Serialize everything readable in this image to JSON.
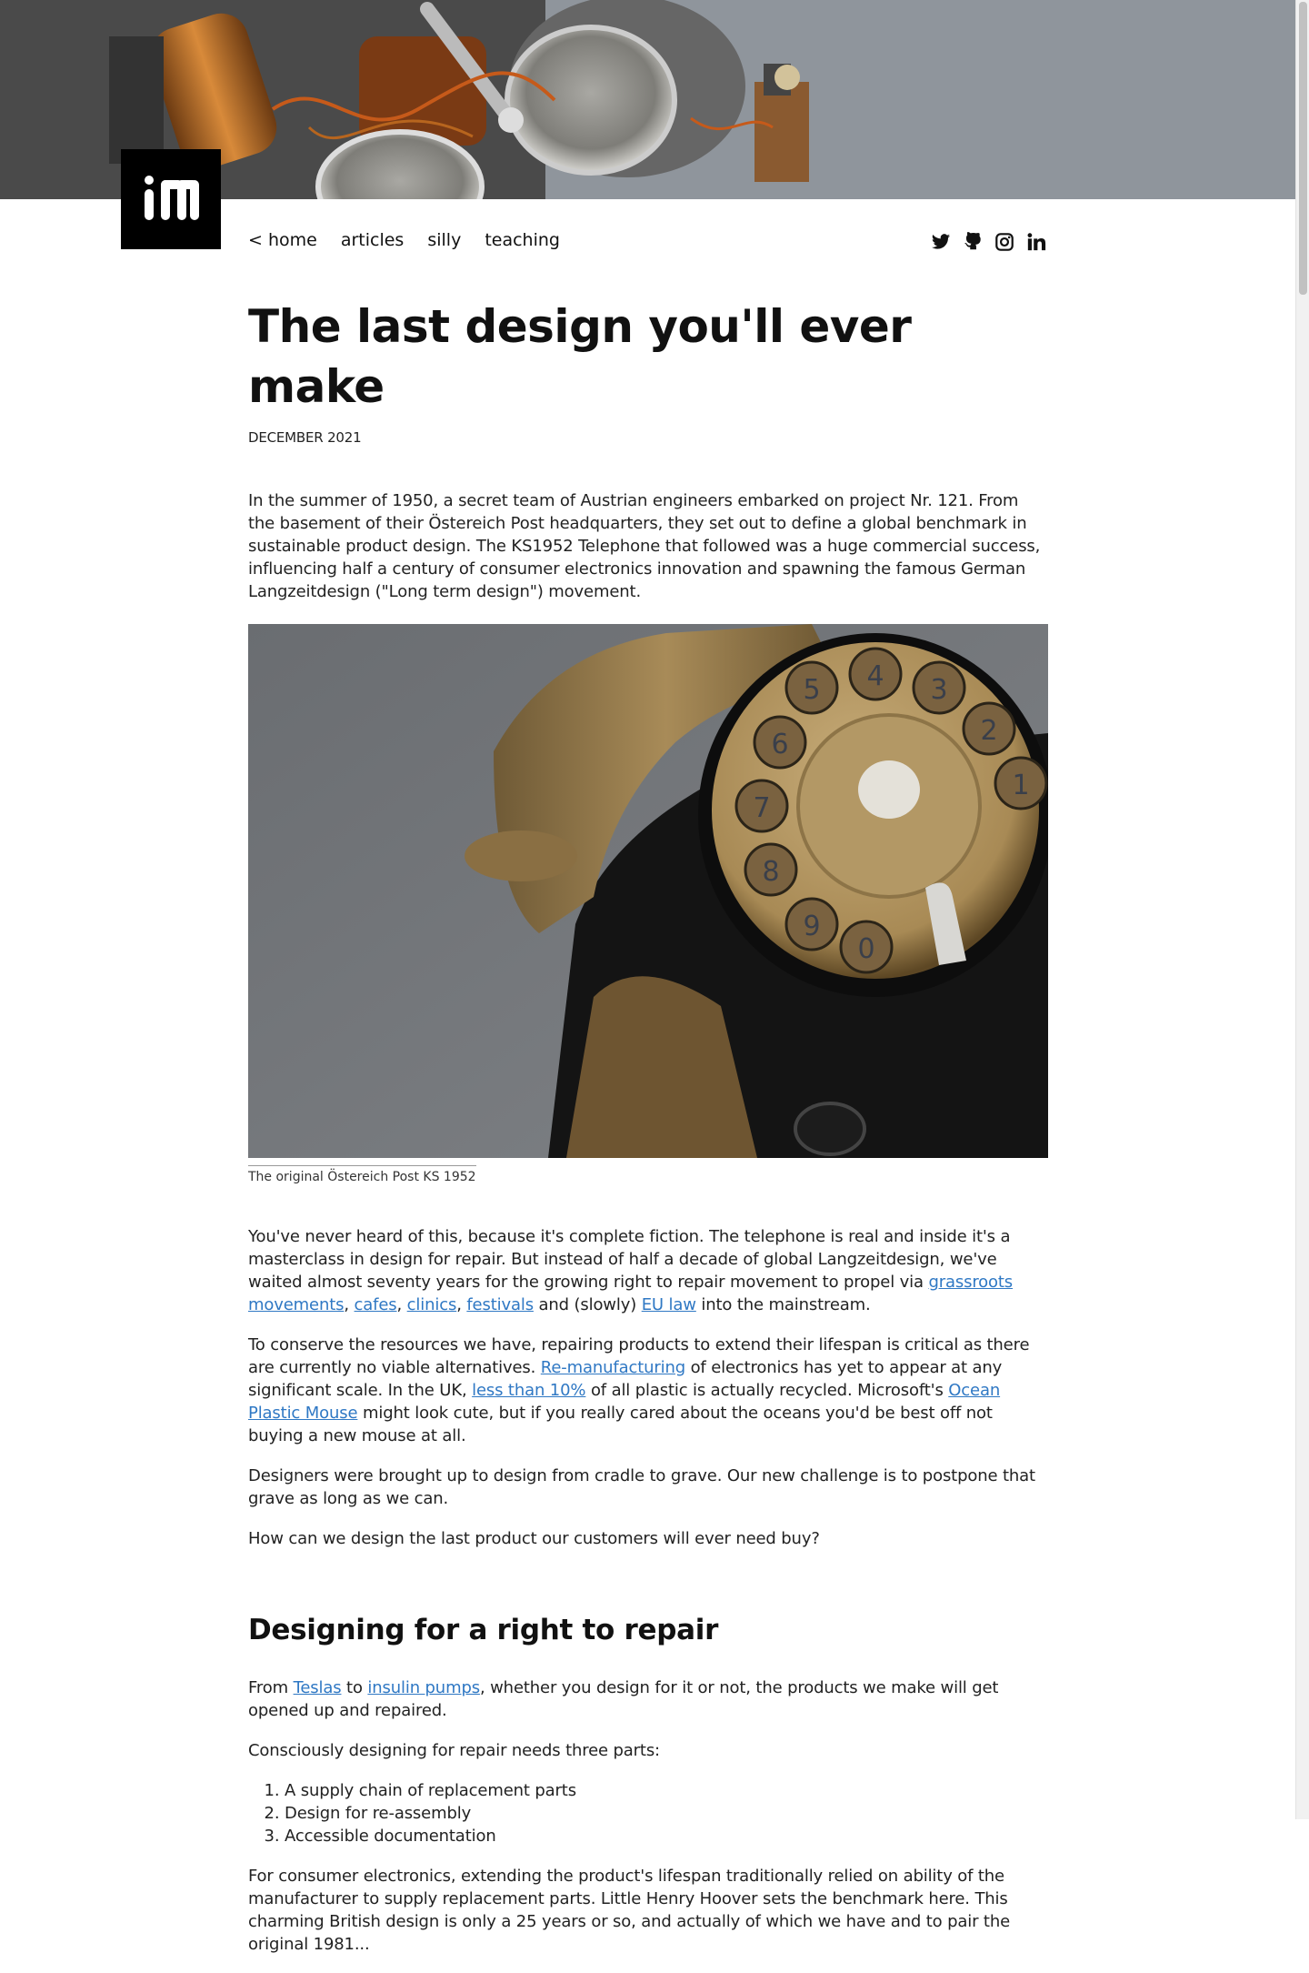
{
  "hero": {
    "alt": "Disassembled telephone internals"
  },
  "logo": {
    "label": "irl logo"
  },
  "nav": {
    "home": "< home",
    "articles": "articles",
    "silly": "silly",
    "teaching": "teaching"
  },
  "social": [
    "twitter-icon",
    "github-icon",
    "instagram-icon",
    "linkedin-icon"
  ],
  "article": {
    "title": "The last design you'll ever make",
    "date": "DECEMBER 2021",
    "intro": "In the summer of 1950, a secret team of Austrian engineers embarked on project Nr. 121. From the basement of their Östereich Post headquarters, they set out to define a global benchmark in sustainable product design. The KS1952 Telephone that followed was a huge commercial success, influencing half a century of consumer electronics innovation and spawning the famous German Langzeitdesign (\"Long term design\") movement.",
    "caption": "The original Östereich Post KS 1952",
    "p2": {
      "a": "You've never heard of this, because it's complete fiction. The telephone is real and inside it's a masterclass in design for repair. But instead of half a decade of global Langzeitdesign, we've waited almost seventy years for the growing right to repair movement to propel via ",
      "link1": "grassroots movements",
      "c1": ", ",
      "link2": "cafes",
      "c2": ", ",
      "link3": "clinics",
      "c3": ", ",
      "link4": "festivals",
      "b": " and (slowly) ",
      "link5": "EU law",
      "c": " into the mainstream."
    },
    "p3": {
      "a": "To conserve the resources we have, repairing products to extend their lifespan is critical as there are currently no viable alternatives. ",
      "link1": "Re-manufacturing",
      "b": " of electronics has yet to appear at any significant scale. In the UK, ",
      "link2": "less than 10%",
      "c": " of all plastic is actually recycled. Microsoft's ",
      "link3": "Ocean Plastic Mouse",
      "d": " might look cute, but if you really cared about the oceans you'd be best off not buying a new mouse at all."
    },
    "p4": "Designers were brought up to design from cradle to grave. Our new challenge is to postpone that grave as long as we can.",
    "p5": "How can we design the last product our customers will ever need buy?",
    "h2": "Designing for a right to repair",
    "p6": {
      "a": "From ",
      "link1": "Teslas",
      "b": " to ",
      "link2": "insulin pumps",
      "c": ", whether you design for it or not, the products we make will get opened up and repaired."
    },
    "p7": "Consciously designing for repair needs three parts:",
    "list": [
      "A supply chain of replacement parts",
      "Design for re-assembly",
      "Accessible documentation"
    ],
    "p8": "For consumer electronics, extending the product's lifespan traditionally relied on ability of the manufacturer to supply replacement parts. Little Henry Hoover sets the benchmark here. This charming British design is only a 25 years or so, and actually of which we have and to pair the original 1981..."
  }
}
